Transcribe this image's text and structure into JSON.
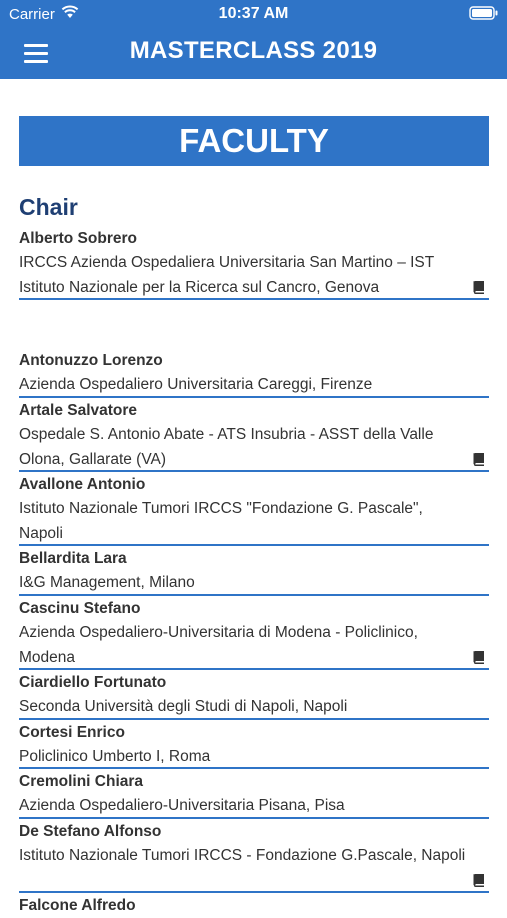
{
  "status": {
    "carrier": "Carrier",
    "time": "10:37 AM"
  },
  "header": {
    "title": "MASTERCLASS 2019"
  },
  "banner": {
    "title": "FACULTY"
  },
  "chair": {
    "section_title": "Chair",
    "name": "Alberto Sobrero",
    "affiliation": "IRCCS Azienda Ospedaliera Universitaria San Martino – IST Istituto Nazionale per la Ricerca sul Cancro, Genova",
    "has_bio": true
  },
  "faculty": [
    {
      "name": "Antonuzzo Lorenzo",
      "affiliation": "Azienda Ospedaliero Universitaria Careggi, Firenze",
      "has_bio": false
    },
    {
      "name": "Artale Salvatore",
      "affiliation": "Ospedale S. Antonio Abate - ATS Insubria - ASST della Valle Olona, Gallarate (VA)",
      "has_bio": true
    },
    {
      "name": "Avallone Antonio",
      "affiliation": "Istituto Nazionale Tumori IRCCS \"Fondazione G. Pascale\", Napoli",
      "has_bio": false
    },
    {
      "name": "Bellardita Lara",
      "affiliation": "I&G Management, Milano",
      "has_bio": false
    },
    {
      "name": "Cascinu Stefano",
      "affiliation": "Azienda Ospedaliero-Universitaria di Modena - Policlinico, Modena",
      "has_bio": true
    },
    {
      "name": "Ciardiello Fortunato",
      "affiliation": "Seconda Università degli Studi di Napoli, Napoli",
      "has_bio": false
    },
    {
      "name": "Cortesi Enrico",
      "affiliation": "Policlinico Umberto I, Roma",
      "has_bio": false
    },
    {
      "name": "Cremolini Chiara",
      "affiliation": "Azienda Ospedaliero-Universitaria Pisana, Pisa",
      "has_bio": false
    },
    {
      "name": "De Stefano Alfonso",
      "affiliation": "Istituto Nazionale Tumori IRCCS - Fondazione G.Pascale, Napoli",
      "has_bio": true
    },
    {
      "name": "Falcone Alfredo",
      "affiliation": "",
      "has_bio": false
    }
  ],
  "icons": {
    "menu": "hamburger-icon",
    "bio": "book-icon",
    "wifi": "wifi-icon",
    "battery": "battery-icon"
  },
  "colors": {
    "primary": "#2f74c7",
    "section_title": "#1f3f73"
  }
}
